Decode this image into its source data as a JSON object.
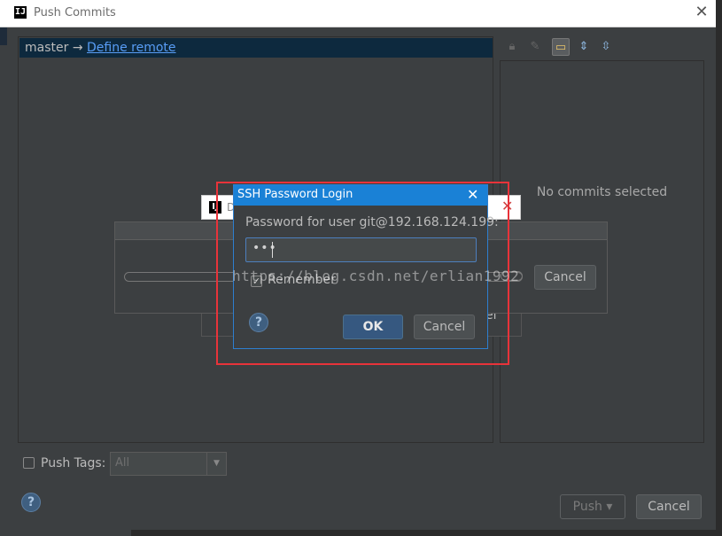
{
  "window": {
    "title": "Push Commits",
    "app_icon": "IJ"
  },
  "branch": {
    "local": "master",
    "arrow": "→",
    "remote_link": "Define remote"
  },
  "toolbar": {
    "icons": [
      "lock-icon",
      "edit-icon",
      "folder-icon",
      "expand-all-icon",
      "collapse-all-icon"
    ]
  },
  "commits_panel": {
    "empty_text": "No commits selected"
  },
  "push_tags": {
    "label": "Push Tags:",
    "combo_value": "All"
  },
  "footer": {
    "help": "?",
    "push_label": "Push",
    "push_arrow": "▾",
    "cancel_label": "Cancel"
  },
  "behind_dialog": {
    "title_partial": "D",
    "cancel_partial": "el"
  },
  "progress_dialog": {
    "cancel_label": "Cancel"
  },
  "ssh_dialog": {
    "title": "SSH Password Login",
    "prompt": "Password for user git@192.168.124.199:",
    "password_mask": "•••",
    "remember_label": "Remember",
    "ok_label": "OK",
    "cancel_label": "Cancel",
    "help": "?"
  },
  "watermark": "https://blog.csdn.net/erlian1992",
  "colors": {
    "background": "#3c3f41",
    "branch_selection": "#0d293e",
    "link": "#589df6",
    "ssh_title_bar": "#1a81d6",
    "highlight_border": "#e8333a"
  }
}
